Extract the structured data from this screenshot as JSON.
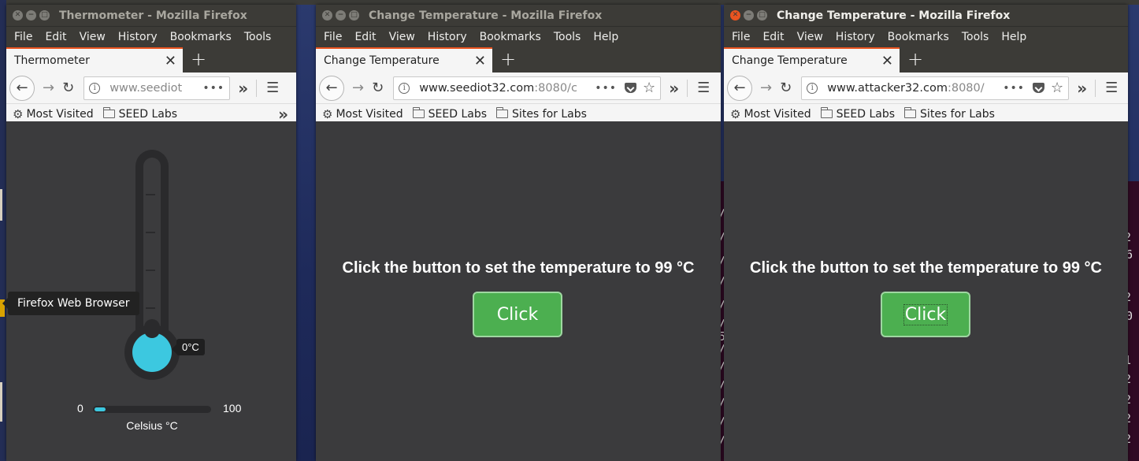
{
  "desktop": {
    "tooltip": "Firefox Web Browser"
  },
  "terminal_fragments": [
    "/",
    "2",
    "=6",
    "/",
    "/",
    "/",
    "2",
    "/",
    "=0",
    "/",
    "5",
    "/",
    "/",
    "1",
    "/",
    "2",
    "/",
    "2",
    "/",
    "2",
    "/",
    "2"
  ],
  "windows": [
    {
      "title": "Thermometer - Mozilla Firefox",
      "active": false,
      "menu": [
        "File",
        "Edit",
        "View",
        "History",
        "Bookmarks",
        "Tools"
      ],
      "tab_title": "Thermometer",
      "url_host": "www.seediot",
      "url_rest": "",
      "bookmarks": [
        "Most Visited",
        "SEED Labs"
      ],
      "thermometer": {
        "temperature_label": "0°C",
        "min": "0",
        "max": "100",
        "value": 0,
        "unit": "Celsius °C"
      }
    },
    {
      "title": "Change Temperature - Mozilla Firefox",
      "active": false,
      "menu": [
        "File",
        "Edit",
        "View",
        "History",
        "Bookmarks",
        "Tools",
        "Help"
      ],
      "tab_title": "Change Temperature",
      "url_host": "www.seediot32.com",
      "url_rest": ":8080/c",
      "bookmarks": [
        "Most Visited",
        "SEED Labs",
        "Sites for Labs"
      ],
      "prompt": "Click the button to set the temperature to 99 °C",
      "button_label": "Click"
    },
    {
      "title": "Change Temperature - Mozilla Firefox",
      "active": true,
      "menu": [
        "File",
        "Edit",
        "View",
        "History",
        "Bookmarks",
        "Tools",
        "Help"
      ],
      "tab_title": "Change Temperature",
      "url_host": "www.attacker32.com",
      "url_rest": ":8080/",
      "bookmarks": [
        "Most Visited",
        "SEED Labs",
        "Sites for Labs"
      ],
      "prompt": "Click the button to set the temperature to 99 °C",
      "button_label": "Click"
    }
  ],
  "icons": {
    "back": "back-arrow-icon",
    "forward": "forward-arrow-icon",
    "reload": "reload-icon",
    "info": "info-icon",
    "more": "more-dots-icon",
    "pocket": "pocket-icon",
    "star": "bookmark-star-icon",
    "overflow": "overflow-chevron-icon",
    "menu": "hamburger-menu-icon",
    "gear": "gear-icon",
    "folder": "folder-icon",
    "close": "close-icon",
    "new_tab": "plus-icon"
  },
  "colors": {
    "accent_tab": "#e95420",
    "button_green": "#4caf50",
    "thermo_fill": "#3cc8e0",
    "page_bg": "#3b3b3d"
  }
}
